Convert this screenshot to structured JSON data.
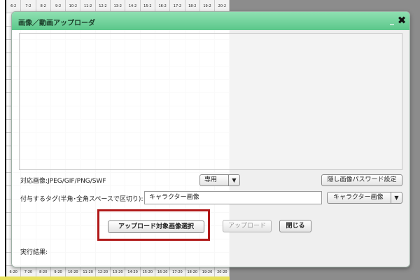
{
  "background": {
    "header_row": [
      "6-2",
      "7-2",
      "8-2",
      "9-2",
      "10-2",
      "11-2",
      "12-2",
      "13-2",
      "14-2",
      "15-2",
      "16-2",
      "17-2",
      "18-2",
      "19-2",
      "20-2"
    ],
    "footer_row": [
      "6-20",
      "7-20",
      "8-20",
      "9-20",
      "10-20",
      "11-20",
      "12-20",
      "13-20",
      "14-20",
      "15-20",
      "16-20",
      "17-20",
      "18-20",
      "19-20",
      "20-20"
    ]
  },
  "dialog": {
    "title": "画像／動画アップローダ",
    "minimize_symbol": "_",
    "close_symbol": "✖",
    "formats_label": "対応画像:JPEG/GIF/PNG/SWF",
    "dedicated_select": {
      "value": "専用",
      "arrow": "▼"
    },
    "hidden_password_button": "隠し画像パスワード設定",
    "tags_label": "付与するタグ(半角･全角スペースで区切り):",
    "tag_input": {
      "value": "キャラクター画像"
    },
    "tag_select": {
      "value": "キャラクター画像",
      "arrow": "▼"
    },
    "select_upload_button": "アップロード対象画像選択",
    "upload_button": "アップロード",
    "close_button": "閉じる",
    "result_label": "実行結果:"
  }
}
